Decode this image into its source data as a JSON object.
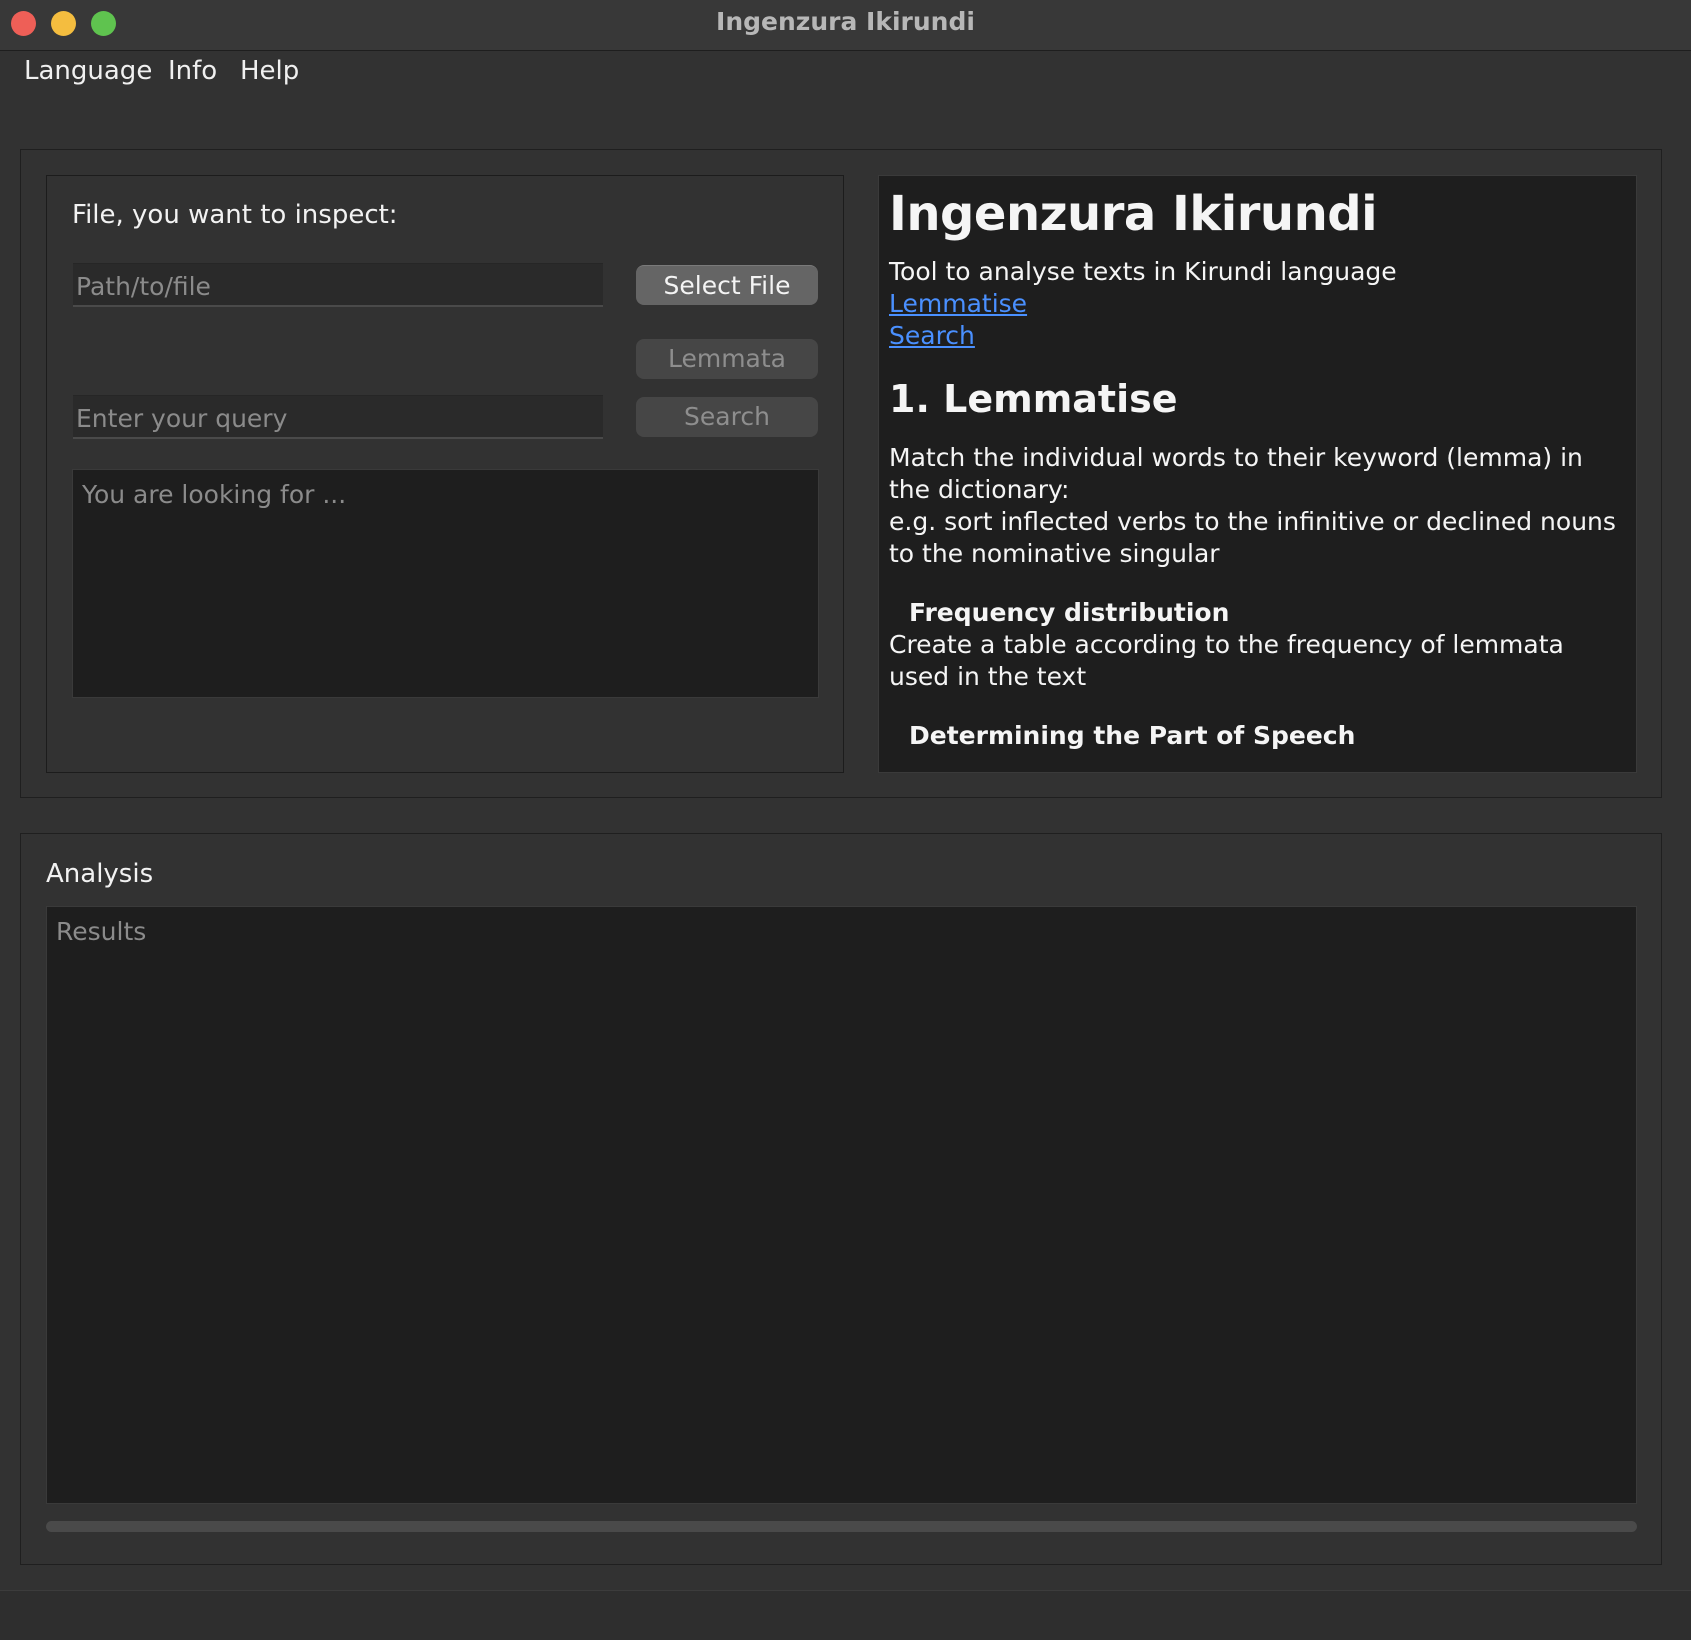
{
  "window": {
    "title": "Ingenzura Ikirundi"
  },
  "menu": {
    "items": [
      "Language",
      "Info",
      "Help"
    ]
  },
  "file_panel": {
    "label": "File, you want to inspect:",
    "path_placeholder": "Path/to/file",
    "path_value": "",
    "select_button": "Select File",
    "lemmata_button": "Lemmata",
    "query_placeholder": "Enter your query",
    "query_value": "",
    "search_button": "Search",
    "looking_placeholder": "You are looking for ..."
  },
  "info": {
    "heading": "Ingenzura Ikirundi",
    "tagline": "Tool to analyse texts in Kirundi language",
    "links": [
      "Lemmatise",
      "Search"
    ],
    "section1_title": "1. Lemmatise",
    "section1_text1": "Match the individual words to their keyword (lemma) in the dictionary:",
    "section1_text2": "e.g. sort inflected verbs to the infinitive or declined nouns to the nominative singular",
    "freq_title": "Frequency distribution",
    "freq_text": "Create a table according to the frequency of lemmata used in the text",
    "pos_title": "Determining the Part of Speech"
  },
  "analysis": {
    "label": "Analysis",
    "results_placeholder": "Results",
    "progress_fraction": 0
  },
  "colors": {
    "link": "#4a90ff",
    "close": "#ee5f57",
    "minimize": "#f4bd3f",
    "maximize": "#5fc34f"
  }
}
